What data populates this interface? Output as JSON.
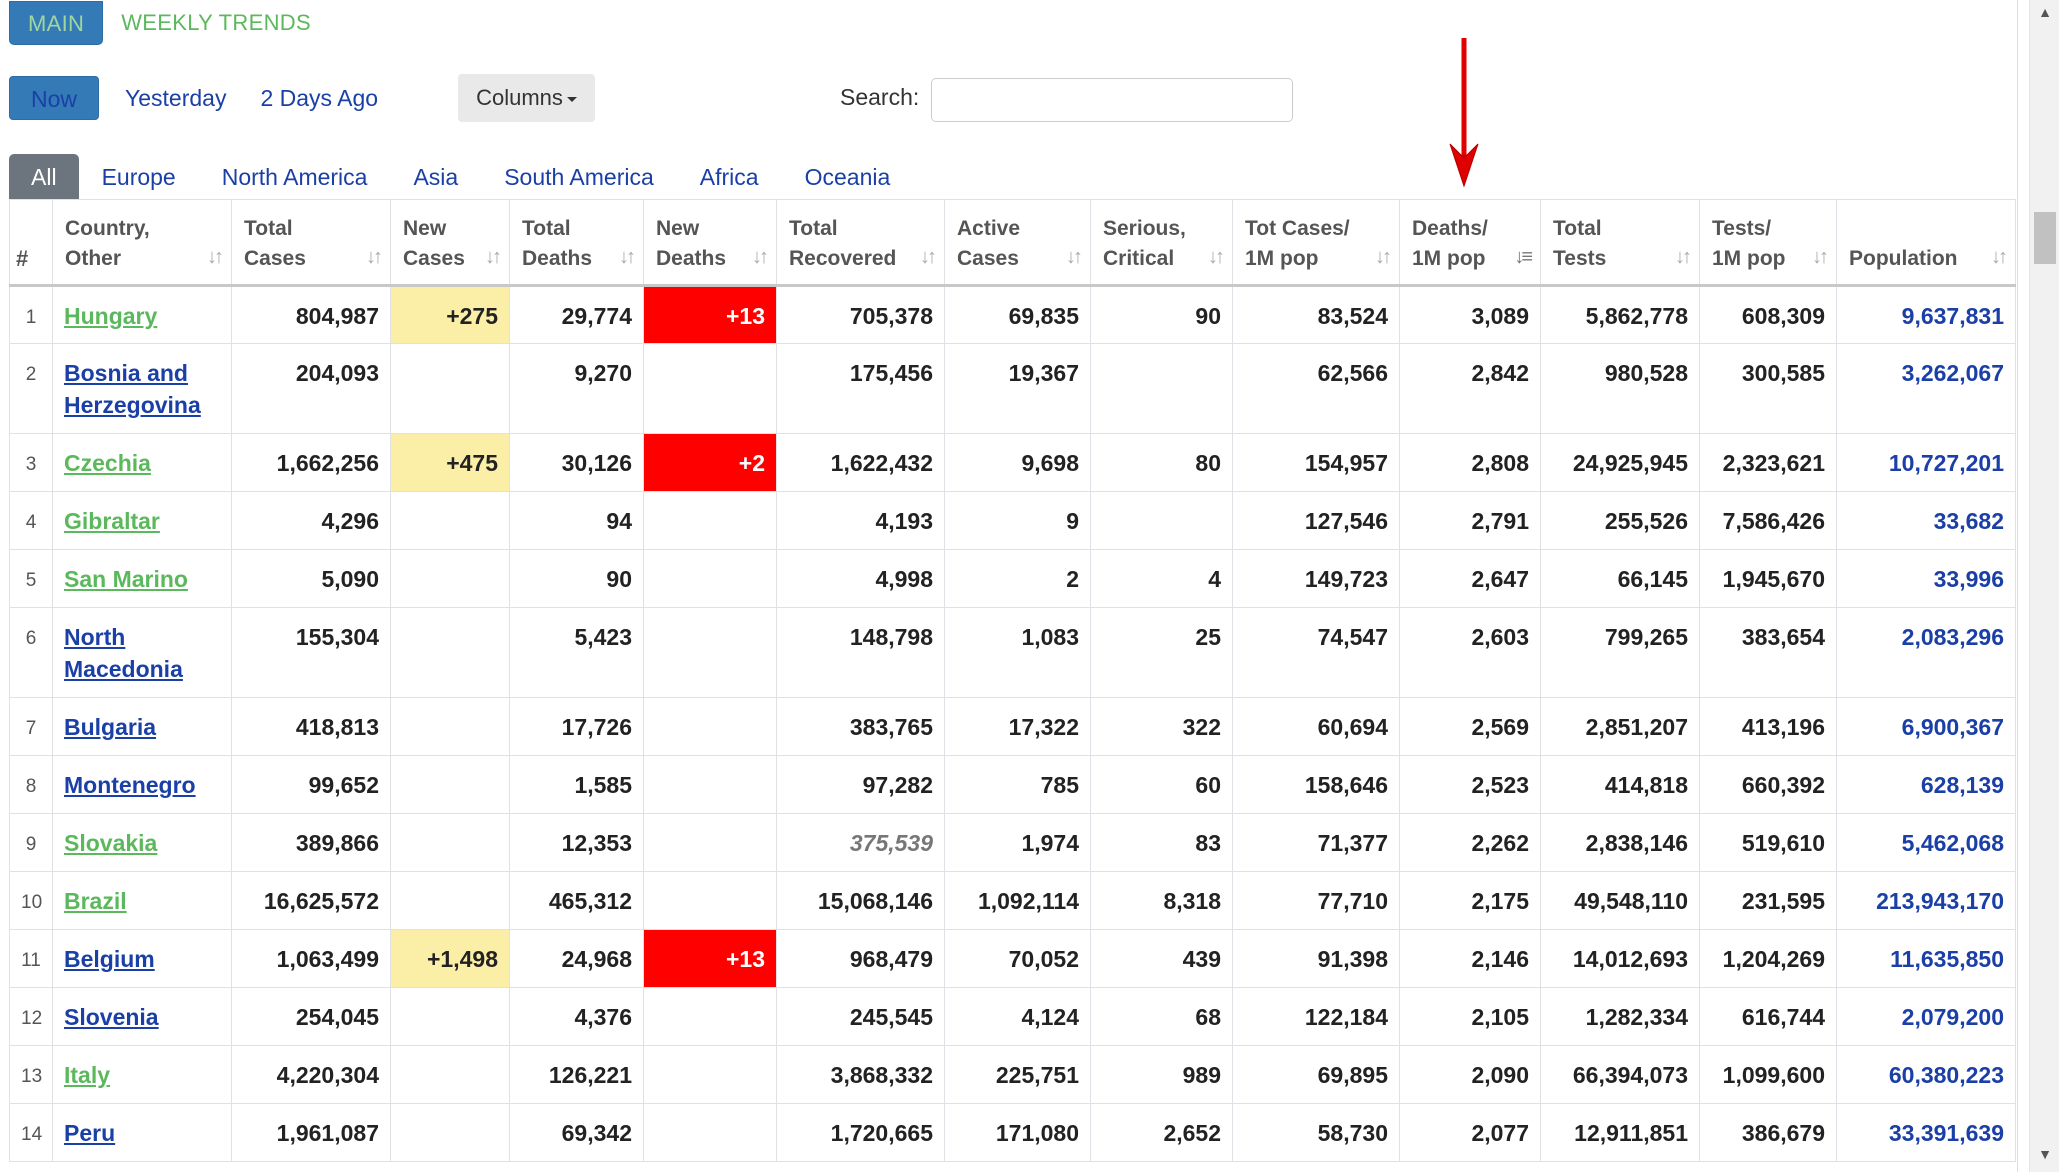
{
  "top_tabs": [
    {
      "label": "MAIN",
      "active": true
    },
    {
      "label": "WEEKLY TRENDS",
      "active": false
    }
  ],
  "time_buttons": [
    {
      "label": "Now",
      "active": true
    },
    {
      "label": "Yesterday",
      "active": false
    },
    {
      "label": "2 Days Ago",
      "active": false
    }
  ],
  "columns_button": {
    "label": "Columns"
  },
  "search": {
    "label": "Search:",
    "value": ""
  },
  "continent_tabs": [
    {
      "label": "All",
      "active": true
    },
    {
      "label": "Europe",
      "active": false
    },
    {
      "label": "North America",
      "active": false
    },
    {
      "label": "Asia",
      "active": false
    },
    {
      "label": "South America",
      "active": false
    },
    {
      "label": "Africa",
      "active": false
    },
    {
      "label": "Oceania",
      "active": false
    }
  ],
  "table": {
    "headers": [
      {
        "line1": "#",
        "line2": ""
      },
      {
        "line1": "Country,",
        "line2": "Other"
      },
      {
        "line1": "Total",
        "line2": "Cases"
      },
      {
        "line1": "New",
        "line2": "Cases"
      },
      {
        "line1": "Total",
        "line2": "Deaths"
      },
      {
        "line1": "New",
        "line2": "Deaths"
      },
      {
        "line1": "Total",
        "line2": "Recovered"
      },
      {
        "line1": "Active",
        "line2": "Cases"
      },
      {
        "line1": "Serious,",
        "line2": "Critical"
      },
      {
        "line1": "Tot Cases/",
        "line2": "1M pop"
      },
      {
        "line1": "Deaths/",
        "line2": "1M pop"
      },
      {
        "line1": "Total",
        "line2": "Tests"
      },
      {
        "line1": "Tests/",
        "line2": "1M pop"
      },
      {
        "line1": "Population",
        "line2": ""
      }
    ],
    "sorted_column": "Deaths/ 1M pop",
    "rows": [
      {
        "num": "1",
        "country": "Hungary",
        "country_color": "green",
        "total_cases": "804,987",
        "new_cases": "+275",
        "total_deaths": "29,774",
        "new_deaths": "+13",
        "total_recovered": "705,378",
        "recovered_italic": false,
        "active_cases": "69,835",
        "serious": "90",
        "cases_per_m": "83,524",
        "deaths_per_m": "3,089",
        "total_tests": "5,862,778",
        "tests_per_m": "608,309",
        "population": "9,637,831"
      },
      {
        "num": "2",
        "country": "Bosnia and Herzegovina",
        "country_color": "blue",
        "total_cases": "204,093",
        "new_cases": "",
        "total_deaths": "9,270",
        "new_deaths": "",
        "total_recovered": "175,456",
        "recovered_italic": false,
        "active_cases": "19,367",
        "serious": "",
        "cases_per_m": "62,566",
        "deaths_per_m": "2,842",
        "total_tests": "980,528",
        "tests_per_m": "300,585",
        "population": "3,262,067"
      },
      {
        "num": "3",
        "country": "Czechia",
        "country_color": "green",
        "total_cases": "1,662,256",
        "new_cases": "+475",
        "total_deaths": "30,126",
        "new_deaths": "+2",
        "total_recovered": "1,622,432",
        "recovered_italic": false,
        "active_cases": "9,698",
        "serious": "80",
        "cases_per_m": "154,957",
        "deaths_per_m": "2,808",
        "total_tests": "24,925,945",
        "tests_per_m": "2,323,621",
        "population": "10,727,201"
      },
      {
        "num": "4",
        "country": "Gibraltar",
        "country_color": "green",
        "total_cases": "4,296",
        "new_cases": "",
        "total_deaths": "94",
        "new_deaths": "",
        "total_recovered": "4,193",
        "recovered_italic": false,
        "active_cases": "9",
        "serious": "",
        "cases_per_m": "127,546",
        "deaths_per_m": "2,791",
        "total_tests": "255,526",
        "tests_per_m": "7,586,426",
        "population": "33,682"
      },
      {
        "num": "5",
        "country": "San Marino",
        "country_color": "green",
        "total_cases": "5,090",
        "new_cases": "",
        "total_deaths": "90",
        "new_deaths": "",
        "total_recovered": "4,998",
        "recovered_italic": false,
        "active_cases": "2",
        "serious": "4",
        "cases_per_m": "149,723",
        "deaths_per_m": "2,647",
        "total_tests": "66,145",
        "tests_per_m": "1,945,670",
        "population": "33,996"
      },
      {
        "num": "6",
        "country": "North Macedonia",
        "country_color": "blue",
        "total_cases": "155,304",
        "new_cases": "",
        "total_deaths": "5,423",
        "new_deaths": "",
        "total_recovered": "148,798",
        "recovered_italic": false,
        "active_cases": "1,083",
        "serious": "25",
        "cases_per_m": "74,547",
        "deaths_per_m": "2,603",
        "total_tests": "799,265",
        "tests_per_m": "383,654",
        "population": "2,083,296"
      },
      {
        "num": "7",
        "country": "Bulgaria",
        "country_color": "blue",
        "total_cases": "418,813",
        "new_cases": "",
        "total_deaths": "17,726",
        "new_deaths": "",
        "total_recovered": "383,765",
        "recovered_italic": false,
        "active_cases": "17,322",
        "serious": "322",
        "cases_per_m": "60,694",
        "deaths_per_m": "2,569",
        "total_tests": "2,851,207",
        "tests_per_m": "413,196",
        "population": "6,900,367"
      },
      {
        "num": "8",
        "country": "Montenegro",
        "country_color": "blue",
        "total_cases": "99,652",
        "new_cases": "",
        "total_deaths": "1,585",
        "new_deaths": "",
        "total_recovered": "97,282",
        "recovered_italic": false,
        "active_cases": "785",
        "serious": "60",
        "cases_per_m": "158,646",
        "deaths_per_m": "2,523",
        "total_tests": "414,818",
        "tests_per_m": "660,392",
        "population": "628,139"
      },
      {
        "num": "9",
        "country": "Slovakia",
        "country_color": "green",
        "total_cases": "389,866",
        "new_cases": "",
        "total_deaths": "12,353",
        "new_deaths": "",
        "total_recovered": "375,539",
        "recovered_italic": true,
        "active_cases": "1,974",
        "serious": "83",
        "cases_per_m": "71,377",
        "deaths_per_m": "2,262",
        "total_tests": "2,838,146",
        "tests_per_m": "519,610",
        "population": "5,462,068"
      },
      {
        "num": "10",
        "country": "Brazil",
        "country_color": "green",
        "total_cases": "16,625,572",
        "new_cases": "",
        "total_deaths": "465,312",
        "new_deaths": "",
        "total_recovered": "15,068,146",
        "recovered_italic": false,
        "active_cases": "1,092,114",
        "serious": "8,318",
        "cases_per_m": "77,710",
        "deaths_per_m": "2,175",
        "total_tests": "49,548,110",
        "tests_per_m": "231,595",
        "population": "213,943,170"
      },
      {
        "num": "11",
        "country": "Belgium",
        "country_color": "blue",
        "total_cases": "1,063,499",
        "new_cases": "+1,498",
        "total_deaths": "24,968",
        "new_deaths": "+13",
        "total_recovered": "968,479",
        "recovered_italic": false,
        "active_cases": "70,052",
        "serious": "439",
        "cases_per_m": "91,398",
        "deaths_per_m": "2,146",
        "total_tests": "14,012,693",
        "tests_per_m": "1,204,269",
        "population": "11,635,850"
      },
      {
        "num": "12",
        "country": "Slovenia",
        "country_color": "blue",
        "total_cases": "254,045",
        "new_cases": "",
        "total_deaths": "4,376",
        "new_deaths": "",
        "total_recovered": "245,545",
        "recovered_italic": false,
        "active_cases": "4,124",
        "serious": "68",
        "cases_per_m": "122,184",
        "deaths_per_m": "2,105",
        "total_tests": "1,282,334",
        "tests_per_m": "616,744",
        "population": "2,079,200"
      },
      {
        "num": "13",
        "country": "Italy",
        "country_color": "green",
        "total_cases": "4,220,304",
        "new_cases": "",
        "total_deaths": "126,221",
        "new_deaths": "",
        "total_recovered": "3,868,332",
        "recovered_italic": false,
        "active_cases": "225,751",
        "serious": "989",
        "cases_per_m": "69,895",
        "deaths_per_m": "2,090",
        "total_tests": "66,394,073",
        "tests_per_m": "1,099,600",
        "population": "60,380,223"
      },
      {
        "num": "14",
        "country": "Peru",
        "country_color": "blue",
        "total_cases": "1,961,087",
        "new_cases": "",
        "total_deaths": "69,342",
        "new_deaths": "",
        "total_recovered": "1,720,665",
        "recovered_italic": false,
        "active_cases": "171,080",
        "serious": "2,652",
        "cases_per_m": "58,730",
        "deaths_per_m": "2,077",
        "total_tests": "12,911,851",
        "tests_per_m": "386,679",
        "population": "33,391,639"
      }
    ]
  },
  "colors": {
    "accent_blue": "#337ab7",
    "link_blue": "#1a3fa6",
    "link_green": "#5cb85c",
    "new_cases_bg": "#fbeea7",
    "new_deaths_bg": "#ff0000",
    "arrow_red": "#e00000"
  }
}
